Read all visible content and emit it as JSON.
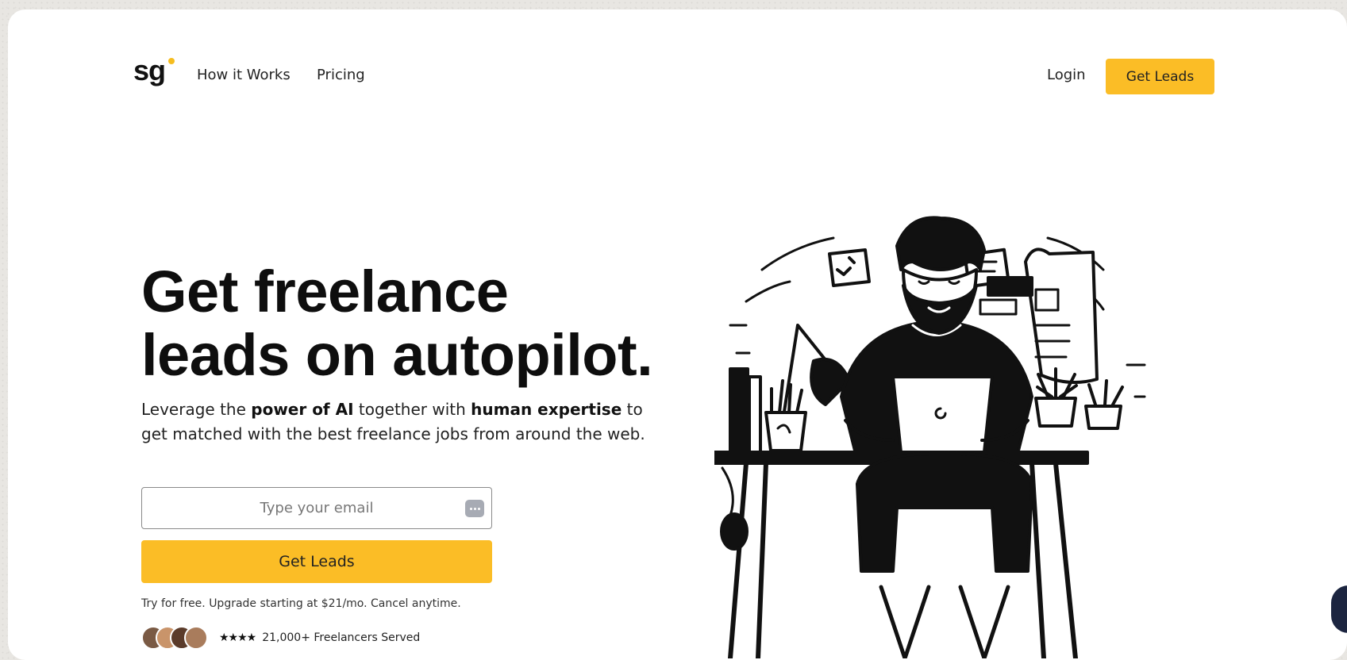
{
  "nav": {
    "logo_text": "sg",
    "links": [
      "How it Works",
      "Pricing"
    ],
    "login_label": "Login",
    "cta_label": "Get Leads"
  },
  "hero": {
    "title_line1": "Get freelance",
    "title_line2": "leads on autopilot.",
    "subtitle": {
      "part1": "Leverage the ",
      "bold1": "power of AI",
      "part2": " together with ",
      "bold2": "human expertise",
      "part3": " to get matched with the best freelance jobs from around the web."
    },
    "email_placeholder": "Type your email",
    "cta_label": "Get Leads",
    "fine_print": "Try for free. Upgrade starting at $21/mo. Cancel anytime.",
    "rating_stars": "★★★★",
    "served_text": "21,000+ Freelancers Served"
  },
  "colors": {
    "accent": "#fbbd26",
    "chat_widget": "#1c2540"
  }
}
